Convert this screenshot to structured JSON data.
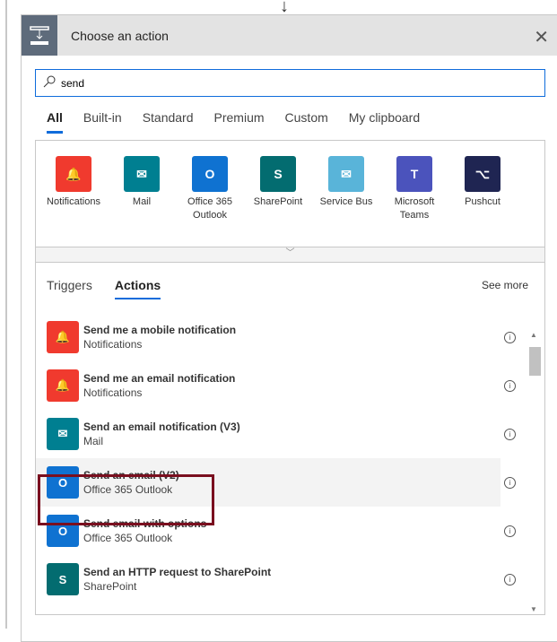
{
  "header": {
    "title": "Choose an action",
    "close": "✕"
  },
  "search": {
    "value": "send"
  },
  "tabs": [
    "All",
    "Built-in",
    "Standard",
    "Premium",
    "Custom",
    "My clipboard"
  ],
  "connectors": [
    {
      "label": "Notifications",
      "color": "#f03a2e",
      "glyph": "🔔"
    },
    {
      "label": "Mail",
      "color": "#007f91",
      "glyph": "✉"
    },
    {
      "label": "Office 365 Outlook",
      "color": "#0f72d1",
      "glyph": "O"
    },
    {
      "label": "SharePoint",
      "color": "#036c70",
      "glyph": "S"
    },
    {
      "label": "Service Bus",
      "color": "#59b4d9",
      "glyph": "✉"
    },
    {
      "label": "Microsoft Teams",
      "color": "#4b53bc",
      "glyph": "T"
    },
    {
      "label": "Pushcut",
      "color": "#1f2552",
      "glyph": "⌥"
    }
  ],
  "subtabs": [
    "Triggers",
    "Actions"
  ],
  "see_more": "See more",
  "actions": [
    {
      "title": "Send me a mobile notification",
      "connector": "Notifications",
      "color": "#f03a2e",
      "glyph": "🔔"
    },
    {
      "title": "Send me an email notification",
      "connector": "Notifications",
      "color": "#f03a2e",
      "glyph": "🔔"
    },
    {
      "title": "Send an email notification (V3)",
      "connector": "Mail",
      "color": "#007f91",
      "glyph": "✉"
    },
    {
      "title": "Send an email (V2)",
      "connector": "Office 365 Outlook",
      "color": "#0f72d1",
      "glyph": "O"
    },
    {
      "title": "Send email with options",
      "connector": "Office 365 Outlook",
      "color": "#0f72d1",
      "glyph": "O"
    },
    {
      "title": "Send an HTTP request to SharePoint",
      "connector": "SharePoint",
      "color": "#036c70",
      "glyph": "S"
    }
  ]
}
